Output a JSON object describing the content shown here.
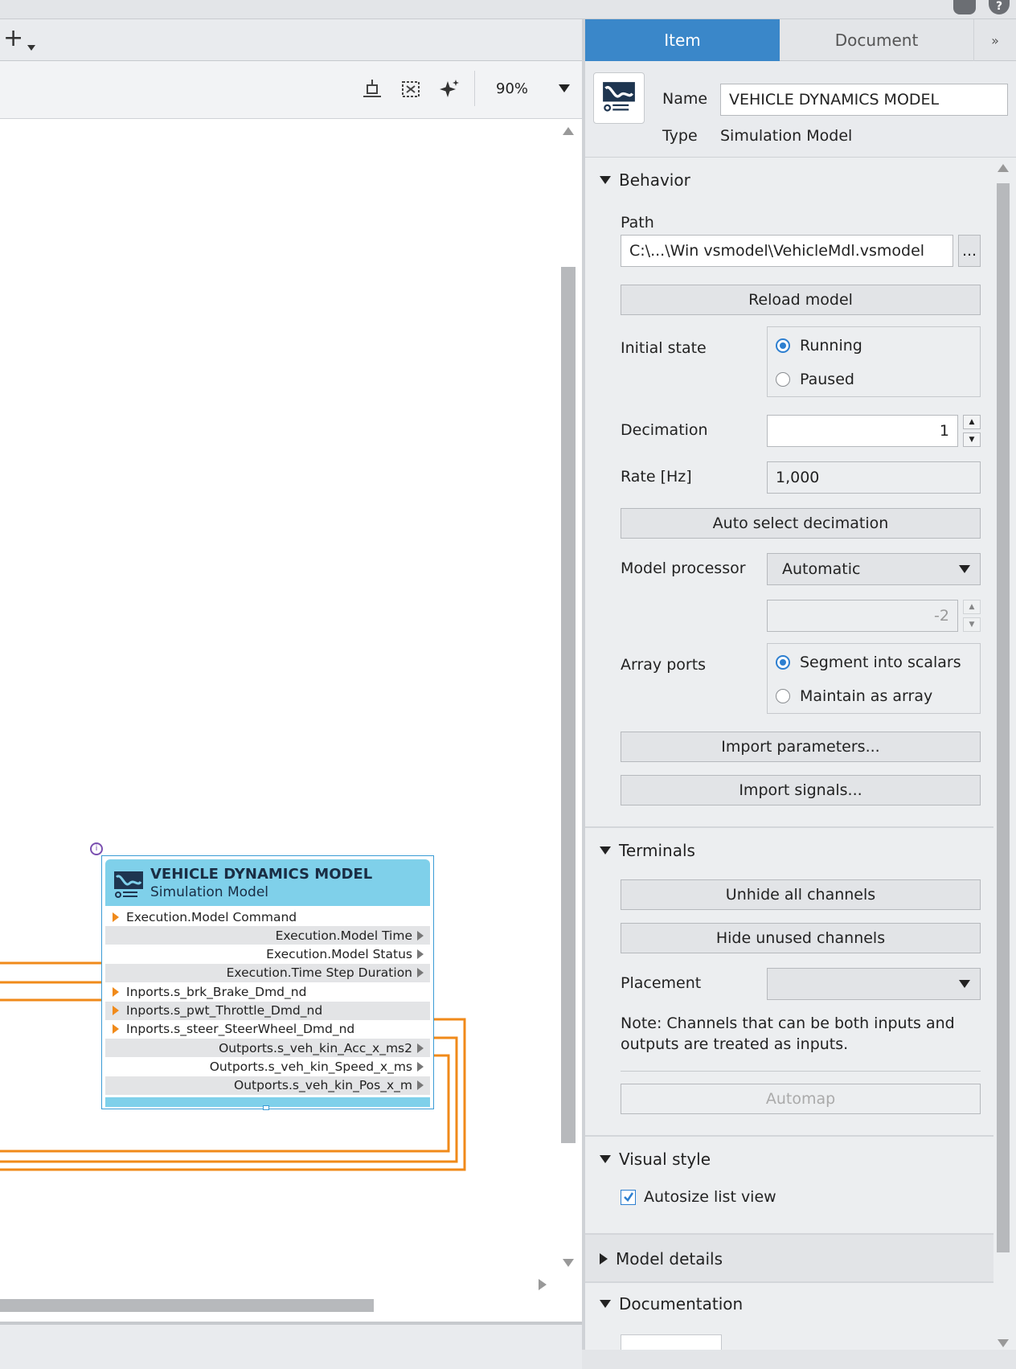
{
  "left_toolbar": {
    "add_label": "+",
    "zoom_value": "90%"
  },
  "tabs": {
    "item": "Item",
    "document": "Document",
    "more": "»"
  },
  "header": {
    "name_label": "Name",
    "name_value": "VEHICLE DYNAMICS MODEL",
    "type_label": "Type",
    "type_value": "Simulation Model"
  },
  "behavior": {
    "title": "Behavior",
    "path_label": "Path",
    "path_value": "C:\\...\\Win vsmodel\\VehicleMdl.vsmodel",
    "browse_label": "...",
    "reload_label": "Reload model",
    "initial_state_label": "Initial state",
    "running_label": "Running",
    "paused_label": "Paused",
    "decimation_label": "Decimation",
    "decimation_value": "1",
    "rate_label": "Rate [Hz]",
    "rate_value": "1,000",
    "auto_select_label": "Auto select decimation",
    "processor_label": "Model processor",
    "processor_value": "Automatic",
    "processor_number": "-2",
    "array_ports_label": "Array ports",
    "segment_label": "Segment into scalars",
    "maintain_label": "Maintain as array",
    "import_params_label": "Import parameters...",
    "import_signals_label": "Import signals..."
  },
  "terminals": {
    "title": "Terminals",
    "unhide_label": "Unhide all channels",
    "hide_label": "Hide unused channels",
    "placement_label": "Placement",
    "placement_value": "",
    "note": "Note: Channels that can be both inputs and outputs are treated as inputs.",
    "automap_label": "Automap"
  },
  "visual_style": {
    "title": "Visual style",
    "autosize_label": "Autosize list view",
    "autosize_checked": true
  },
  "model_details": {
    "title": "Model details"
  },
  "documentation": {
    "title": "Documentation"
  },
  "block": {
    "title": "VEHICLE DYNAMICS MODEL",
    "subtitle": "Simulation Model",
    "rows": [
      {
        "label": "Execution.Model Command",
        "dir": "in"
      },
      {
        "label": "Execution.Model Time",
        "dir": "out"
      },
      {
        "label": "Execution.Model Status",
        "dir": "out"
      },
      {
        "label": "Execution.Time Step Duration",
        "dir": "out"
      },
      {
        "label": "Inports.s_brk_Brake_Dmd_nd",
        "dir": "in"
      },
      {
        "label": "Inports.s_pwt_Throttle_Dmd_nd",
        "dir": "in"
      },
      {
        "label": "Inports.s_steer_SteerWheel_Dmd_nd",
        "dir": "in"
      },
      {
        "label": "Outports.s_veh_kin_Acc_x_ms2",
        "dir": "out"
      },
      {
        "label": "Outports.s_veh_kin_Speed_x_ms",
        "dir": "out"
      },
      {
        "label": "Outports.s_veh_kin_Pos_x_m",
        "dir": "out"
      }
    ]
  },
  "colors": {
    "accent": "#3a87c9",
    "block_header": "#7fd0ea",
    "wire": "#f08a1a"
  }
}
